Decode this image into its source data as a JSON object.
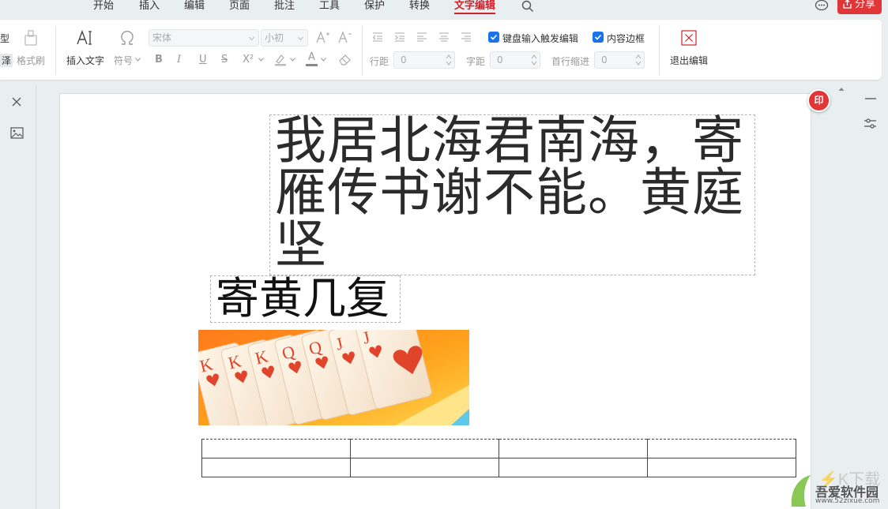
{
  "menu": {
    "tabs": [
      {
        "label": "开始"
      },
      {
        "label": "插入"
      },
      {
        "label": "编辑"
      },
      {
        "label": "页面"
      },
      {
        "label": "批注"
      },
      {
        "label": "工具"
      },
      {
        "label": "保护"
      },
      {
        "label": "转换"
      },
      {
        "label": "文字编辑"
      }
    ],
    "active_tab": "文字编辑",
    "share_label": "分享"
  },
  "ribbon": {
    "cut_left_top": "型",
    "cut_left_bottom": "泽",
    "format_painter": "格式刷",
    "insert_text": "插入文字",
    "symbol": "符号",
    "font_name": "宋体",
    "font_size": "小初",
    "bold": "B",
    "italic": "I",
    "underline": "U",
    "strike": "S",
    "superscript": "X²",
    "font_color": "A",
    "keyboard_edit": "键盘输入触发编辑",
    "content_border": "内容边框",
    "line_spacing_label": "行距",
    "line_spacing_value": "0",
    "char_spacing_label": "字距",
    "char_spacing_value": "0",
    "indent_label": "首行缩进",
    "indent_value": "0",
    "exit_edit": "退出编辑"
  },
  "document": {
    "textbox1": "我居北海君南海，寄雁传书谢不能。黄庭坚",
    "textbox2": "寄黄几复",
    "page_badge": "印",
    "table": {
      "rows": 2,
      "cols": 4
    }
  },
  "watermark": {
    "title": "吾爱软件园",
    "url": "www.52zixue.com"
  },
  "colors": {
    "accent": "#d0222a",
    "check": "#1a73e8",
    "share": "#e03638"
  }
}
